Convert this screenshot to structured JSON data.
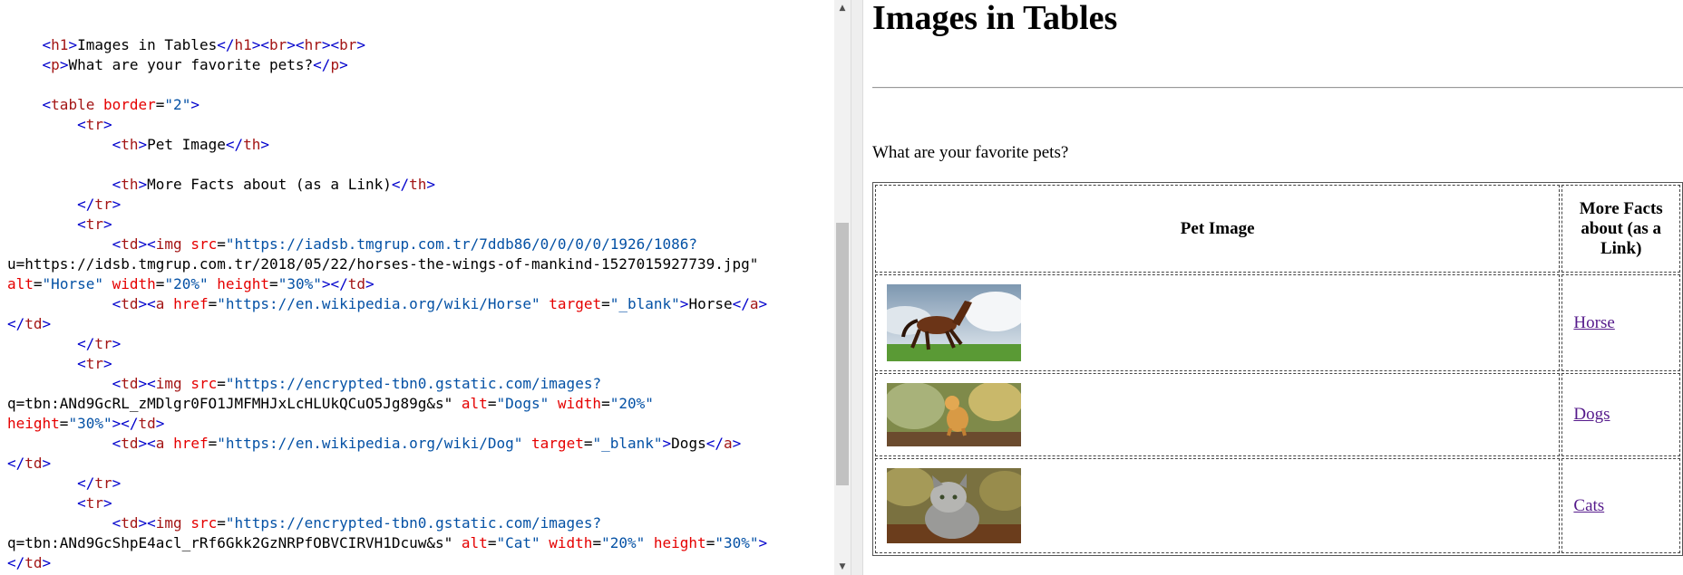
{
  "editor": {
    "lines": [
      "    <h1>Images in Tables</h1><br><hr><br>",
      "    <p>What are your favorite pets?</p>",
      "",
      "    <table border=\"2\">",
      "        <tr>",
      "            <th>Pet Image</th>",
      "",
      "            <th>More Facts about (as a Link)</th>",
      "        </tr>",
      "        <tr>",
      "            <td><img src=\"https://iadsb.tmgrup.com.tr/7ddb86/0/0/0/0/1926/1086?",
      "u=https://idsb.tmgrup.com.tr/2018/05/22/horses-the-wings-of-mankind-1527015927739.jpg\"",
      "alt=\"Horse\" width=\"20%\" height=\"30%\"></td>",
      "            <td><a href=\"https://en.wikipedia.org/wiki/Horse\" target=\"_blank\">Horse</a>",
      "</td>",
      "        </tr>",
      "        <tr>",
      "            <td><img src=\"https://encrypted-tbn0.gstatic.com/images?",
      "q=tbn:ANd9GcRL_zMDlgr0FO1JMFMHJxLcHLUkQCuO5Jg89g&s\" alt=\"Dogs\" width=\"20%\"",
      "height=\"30%\"></td>",
      "            <td><a href=\"https://en.wikipedia.org/wiki/Dog\" target=\"_blank\">Dogs</a>",
      "</td>",
      "        </tr>",
      "        <tr>",
      "            <td><img src=\"https://encrypted-tbn0.gstatic.com/images?",
      "q=tbn:ANd9GcShpE4acl_rRf6Gkk2GzNRPfOBVCIRVH1Dcuw&s\" alt=\"Cat\" width=\"20%\" height=\"30%\">",
      "</td>"
    ]
  },
  "preview": {
    "heading": "Images in Tables",
    "question": "What are your favorite pets?",
    "table": {
      "headers": [
        "Pet Image",
        "More Facts about (as a Link)"
      ],
      "rows": [
        {
          "image_alt": "Horse",
          "link": "Horse",
          "image_height": 85
        },
        {
          "image_alt": "Dogs",
          "link": "Dogs",
          "image_height": 70
        },
        {
          "image_alt": "Cat",
          "link": "Cats",
          "image_height": 83
        }
      ]
    },
    "link_color": "#551a8b"
  },
  "colors": {
    "tag": "#0000cc",
    "tag_name": "#a31515",
    "attribute": "#e50000",
    "attribute_value": "#0451a5"
  }
}
